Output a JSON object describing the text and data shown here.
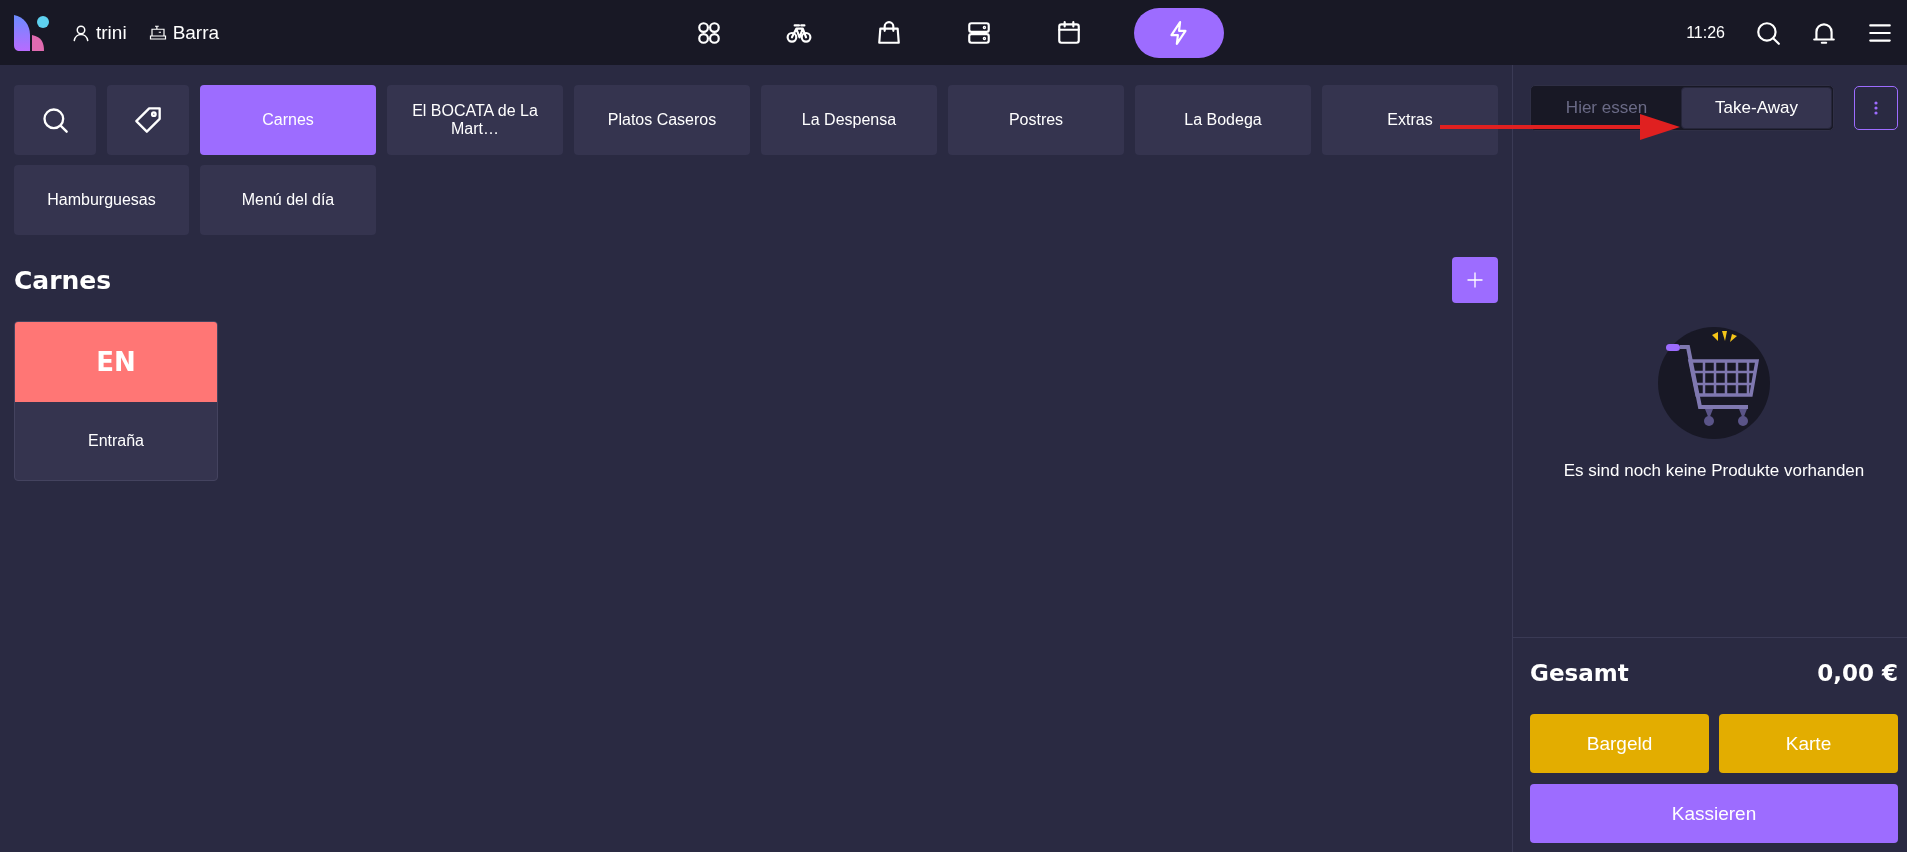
{
  "header": {
    "user": "trini",
    "register": "Barra",
    "time": "11:26",
    "nav": [
      {
        "kind": "apps",
        "selected": false
      },
      {
        "kind": "bike",
        "selected": false
      },
      {
        "kind": "bag",
        "selected": false
      },
      {
        "kind": "server",
        "selected": false
      },
      {
        "kind": "calendar",
        "selected": false
      },
      {
        "kind": "bolt",
        "selected": true
      }
    ]
  },
  "categories": [
    {
      "label": "Carnes",
      "selected": true
    },
    {
      "label": "El BOCATA de La Mart…",
      "selected": false
    },
    {
      "label": "Platos Caseros",
      "selected": false
    },
    {
      "label": "La Despensa",
      "selected": false
    },
    {
      "label": "Postres",
      "selected": false
    },
    {
      "label": "La Bodega",
      "selected": false
    },
    {
      "label": "Extras",
      "selected": false
    },
    {
      "label": "Hamburguesas",
      "selected": false
    },
    {
      "label": "Menú del día",
      "selected": false
    }
  ],
  "section": {
    "title": "Carnes"
  },
  "products": [
    {
      "initials": "EN",
      "name": "Entraña",
      "color": "#ff7675"
    }
  ],
  "order": {
    "modes": [
      {
        "label": "Hier essen",
        "selected": false
      },
      {
        "label": "Take-Away",
        "selected": true
      }
    ],
    "empty_message": "Es sind noch keine Produkte vorhanden",
    "total_label": "Gesamt",
    "total": "0,00 €",
    "buttons": [
      {
        "label": "Bargeld",
        "kind": "cash"
      },
      {
        "label": "Karte",
        "kind": "card"
      },
      {
        "label": "Kassieren",
        "kind": "checkout"
      }
    ]
  },
  "annotations": [
    {
      "kind": "arrow"
    }
  ]
}
